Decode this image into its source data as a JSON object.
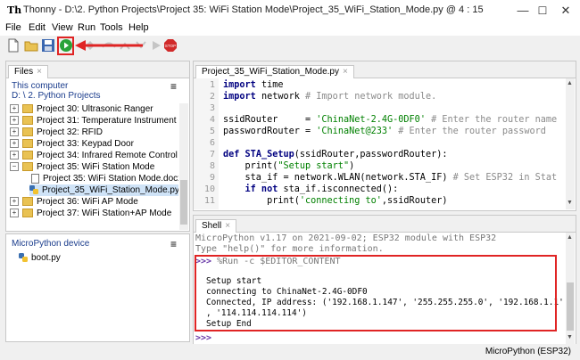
{
  "window": {
    "app_icon": "Th",
    "title": "Thonny  -  D:\\2. Python Projects\\Project 35:  WiFi Station Mode\\Project_35_WiFi_Station_Mode.py  @  4 : 15",
    "minimize": "—",
    "maximize": "☐",
    "close": "✕"
  },
  "menu": [
    "File",
    "Edit",
    "View",
    "Run",
    "Tools",
    "Help"
  ],
  "toolbar": {
    "icons": [
      "new-file-icon",
      "open-file-icon",
      "save-icon",
      "run-icon",
      "debug-icon",
      "step-over-icon",
      "step-into-icon",
      "step-out-icon",
      "resume-icon",
      "stop-icon"
    ],
    "stop_label": "STOP"
  },
  "files_panel": {
    "tab": "Files",
    "tab_close": "×",
    "menu_glyph": "≡",
    "location_title": "This computer",
    "location_path": "D: \\ 2. Python Projects",
    "items": [
      {
        "label": "Project 30:  Ultrasonic Ranger",
        "type": "folder",
        "expander": "+"
      },
      {
        "label": "Project 31:  Temperature Instrument",
        "type": "folder",
        "expander": "+"
      },
      {
        "label": "Project 32:  RFID",
        "type": "folder",
        "expander": "+"
      },
      {
        "label": "Project 33:   Keypad Door",
        "type": "folder",
        "expander": "+"
      },
      {
        "label": "Project 34:  Infrared Remote Control Sou",
        "type": "folder",
        "expander": "+"
      },
      {
        "label": "Project 35:  WiFi Station Mode",
        "type": "folder",
        "expander": "−"
      },
      {
        "label": "Project 35:  WiFi Station Mode.docx",
        "type": "doc"
      },
      {
        "label": "Project_35_WiFi_Station_Mode.py",
        "type": "py",
        "selected": true
      },
      {
        "label": "Project 36:  WiFi AP Mode",
        "type": "folder",
        "expander": "+"
      },
      {
        "label": "Project 37:  WiFi Station+AP Mode",
        "type": "folder",
        "expander": "+"
      }
    ]
  },
  "device_panel": {
    "title": "MicroPython device",
    "menu_glyph": "≡",
    "items": [
      {
        "label": "boot.py"
      }
    ]
  },
  "editor": {
    "tab": "Project_35_WiFi_Station_Mode.py",
    "tab_close": "×",
    "line_numbers": [
      "1",
      "2",
      "3",
      "4",
      "5",
      "6",
      "7",
      "8",
      "9",
      "10",
      "11"
    ]
  },
  "shell": {
    "tab": "Shell",
    "tab_close": "×",
    "banner1": "MicroPython v1.17 on 2021-09-02; ESP32 module with ESP32",
    "banner2": "Type \"help()\" for more information.",
    "prompt": ">>>",
    "command": " %Run -c $EDITOR_CONTENT",
    "output": [
      "Setup start",
      "connecting to ChinaNet-2.4G-0DF0",
      "Connected, IP address: ('192.168.1.147', '255.255.255.0', '192.168.1.1'",
      ", '114.114.114.114')",
      "Setup End"
    ],
    "final_prompt": ">>>"
  },
  "status": {
    "interpreter": "MicroPython (ESP32)"
  },
  "colors": {
    "highlight": "#e02424",
    "keyword": "#000080",
    "string": "#008000",
    "comment": "#8a8a8a",
    "selection": "#cfe3f7"
  }
}
